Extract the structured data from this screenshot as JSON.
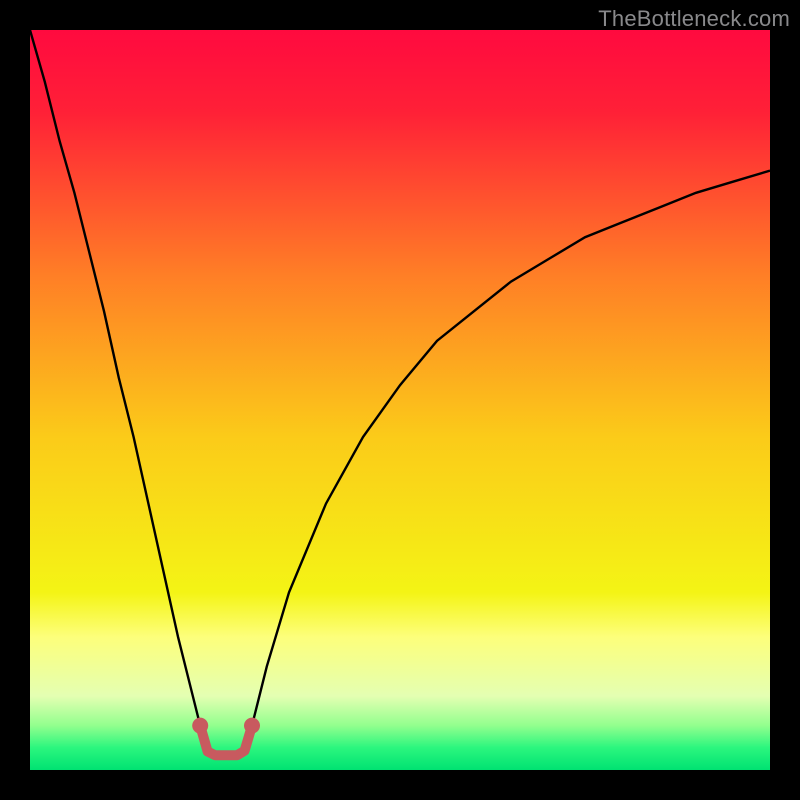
{
  "watermark": "TheBottleneck.com",
  "chart_data": {
    "type": "line",
    "title": "",
    "xlabel": "",
    "ylabel": "",
    "xlim": [
      0,
      100
    ],
    "ylim": [
      0,
      100
    ],
    "grid": false,
    "legend": false,
    "background_gradient": [
      {
        "pos": 0.0,
        "color": "#ff0a3f"
      },
      {
        "pos": 0.11,
        "color": "#ff2037"
      },
      {
        "pos": 0.33,
        "color": "#ff7e26"
      },
      {
        "pos": 0.55,
        "color": "#fbcb19"
      },
      {
        "pos": 0.76,
        "color": "#f4f415"
      },
      {
        "pos": 0.82,
        "color": "#fdff7b"
      },
      {
        "pos": 0.9,
        "color": "#e4ffb2"
      },
      {
        "pos": 0.94,
        "color": "#92ff8e"
      },
      {
        "pos": 0.97,
        "color": "#2bf67e"
      },
      {
        "pos": 1.0,
        "color": "#00e272"
      }
    ],
    "series": [
      {
        "name": "left-curve",
        "color": "#000000",
        "x": [
          0,
          2,
          4,
          6,
          8,
          10,
          12,
          14,
          16,
          18,
          20,
          22,
          23,
          24,
          25,
          26
        ],
        "y": [
          100,
          93,
          85,
          78,
          70,
          62,
          53,
          45,
          36,
          27,
          18,
          10,
          6,
          2.5,
          2,
          2
        ]
      },
      {
        "name": "right-curve",
        "color": "#000000",
        "x": [
          26,
          27,
          28,
          29,
          30,
          32,
          35,
          40,
          45,
          50,
          55,
          60,
          65,
          70,
          75,
          80,
          85,
          90,
          95,
          100
        ],
        "y": [
          2,
          2,
          2,
          2.6,
          6,
          14,
          24,
          36,
          45,
          52,
          58,
          62,
          66,
          69,
          72,
          74,
          76,
          78,
          79.5,
          81
        ]
      }
    ],
    "marker": {
      "name": "bottom-highlight",
      "color": "#c85a5f",
      "points": [
        {
          "x": 23.0,
          "y": 6.0
        },
        {
          "x": 24.0,
          "y": 2.5
        },
        {
          "x": 25.0,
          "y": 2.0
        },
        {
          "x": 26.0,
          "y": 2.0
        },
        {
          "x": 27.0,
          "y": 2.0
        },
        {
          "x": 28.0,
          "y": 2.0
        },
        {
          "x": 29.0,
          "y": 2.6
        },
        {
          "x": 30.0,
          "y": 6.0
        }
      ]
    }
  }
}
